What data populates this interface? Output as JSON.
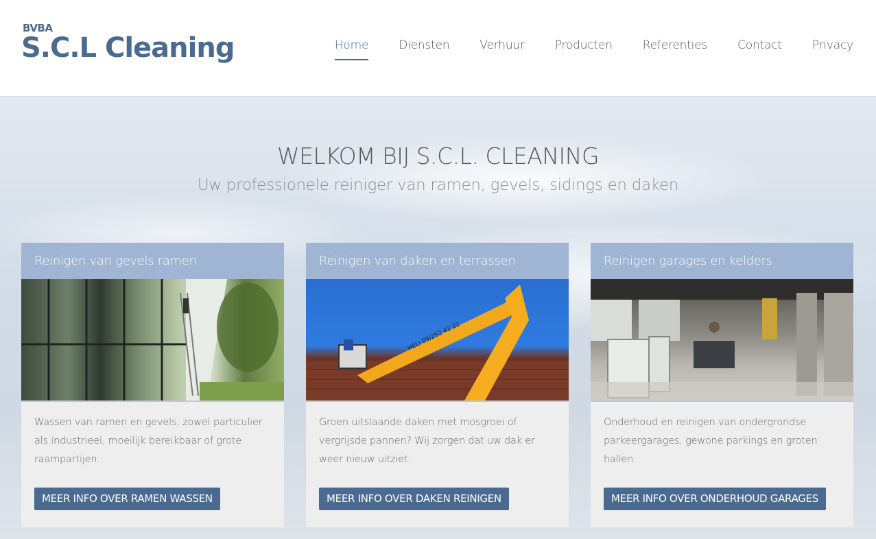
{
  "header": {
    "logo_small": "BVBA",
    "logo_main": "S.C.L Cleaning",
    "nav": [
      {
        "label": "Home",
        "active": true
      },
      {
        "label": "Diensten"
      },
      {
        "label": "Verhuur"
      },
      {
        "label": "Producten"
      },
      {
        "label": "Referenties"
      },
      {
        "label": "Contact"
      },
      {
        "label": "Privacy"
      }
    ]
  },
  "hero": {
    "title": "WELKOM BIJ S.C.L. CLEANING",
    "subtitle": "Uw professionele reiniger van ramen, gevels, sidings en daken"
  },
  "cards": [
    {
      "title": "Reinigen van gevels ramen",
      "text": "Wassen van ramen en gevels, zowel particulier als industrieel, moeilijk bereikbaar of grote raampartijen.",
      "button": "MEER INFO OVER RAMEN WASSEN"
    },
    {
      "title": "Reinigen van daken en terrassen",
      "text": "Groen uitslaande daken met mosgroei of vergrijsde pannen? Wij zorgen dat uw dak er weer nieuw uitziet.",
      "button": "MEER INFO OVER DAKEN REINIGEN",
      "lift_label": "HELI 09/252 42 22"
    },
    {
      "title": "Reinigen garages en kelders",
      "text": "Onderhoud en reinigen van ondergrondse parkeergarages, gewone parkings en groten hallen.",
      "button": "MEER INFO OVER ONDERHOUD GARAGES"
    }
  ],
  "colors": {
    "brand": "#4a6a8f",
    "card_header": "#9fb5d3",
    "card_body": "#eeeeee"
  }
}
